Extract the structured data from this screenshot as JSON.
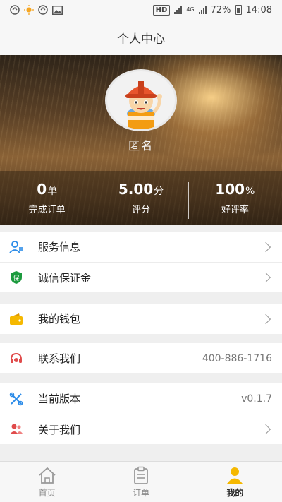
{
  "status_bar": {
    "battery": "72%",
    "time": "14:08",
    "network": "HD",
    "sim_label": "4G",
    "icons": [
      "sync-icon",
      "sun-icon",
      "sync-icon",
      "image-icon"
    ]
  },
  "title": "个人中心",
  "profile": {
    "name": "匿名",
    "avatar": "worker-avatar"
  },
  "stats": [
    {
      "value": "0",
      "unit": "单",
      "label": "完成订单"
    },
    {
      "value": "5.00",
      "unit": "分",
      "label": "评分"
    },
    {
      "value": "100",
      "unit": "%",
      "label": "好评率"
    }
  ],
  "menu": {
    "service_info": "服务信息",
    "deposit": "诚信保证金",
    "deposit_badge": "保",
    "wallet": "我的钱包",
    "contact": "联系我们",
    "contact_phone": "400-886-1716",
    "version": "当前版本",
    "version_value": "v0.1.7",
    "about": "关于我们"
  },
  "tabbar": {
    "home": "首页",
    "orders": "订单",
    "mine": "我的"
  },
  "colors": {
    "accent": "#f5b800",
    "icon_blue": "#2a8be8",
    "icon_green": "#1c9a3e",
    "icon_red": "#e04b4b"
  }
}
